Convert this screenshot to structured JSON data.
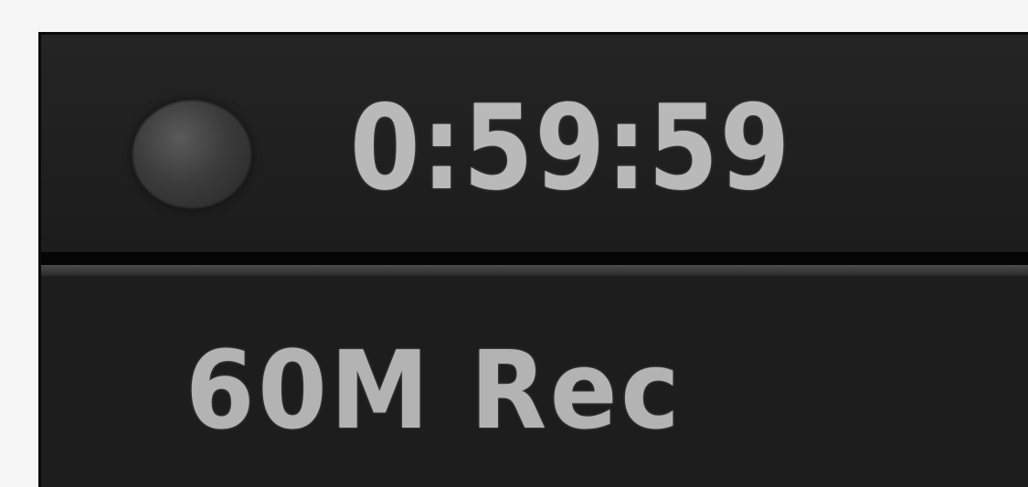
{
  "recorder": {
    "timecode": "0:59:59",
    "record_mode": "60M Rec",
    "indicator_icon": "record-indicator-icon",
    "colors": {
      "panel_background": "#1b1b1b",
      "text": "#b9b9b9",
      "indicator": "#3c3c3c"
    }
  }
}
